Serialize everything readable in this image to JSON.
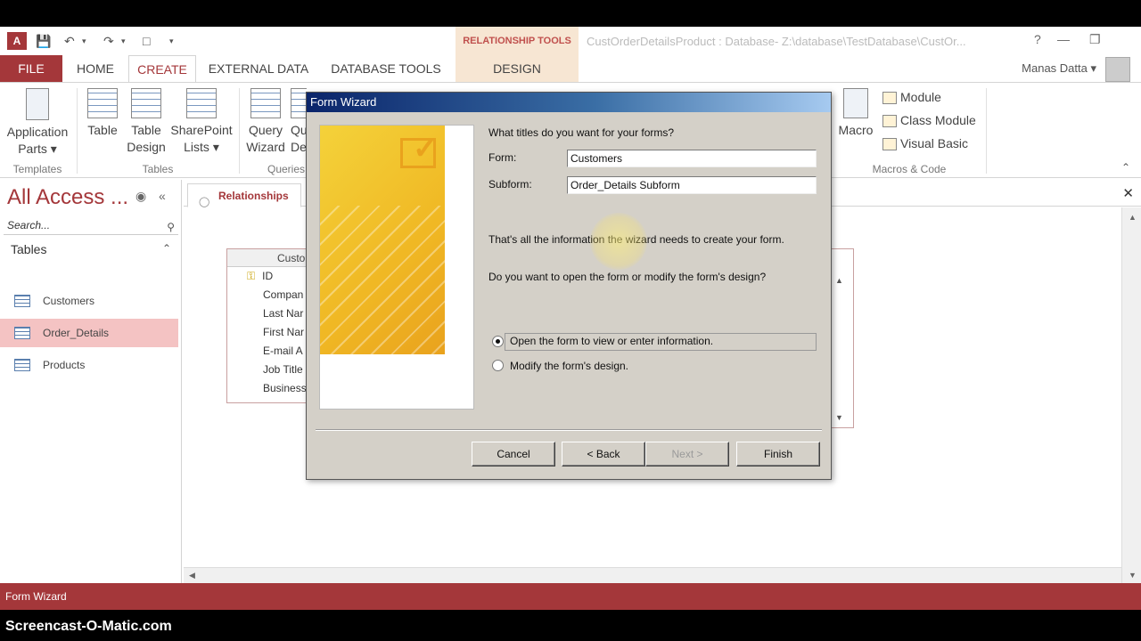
{
  "app": {
    "window_title": "CustOrderDetailsProduct : Database- Z:\\database\\TestDatabase\\CustOr...",
    "user_name": "Manas Datta",
    "contextual_group": "RELATIONSHIP TOOLS"
  },
  "ribbon_tabs": [
    {
      "label": "FILE"
    },
    {
      "label": "HOME"
    },
    {
      "label": "CREATE"
    },
    {
      "label": "EXTERNAL DATA"
    },
    {
      "label": "DATABASE TOOLS"
    },
    {
      "label": "DESIGN"
    }
  ],
  "ribbon": {
    "app_parts": "Application Parts ▾",
    "table": "Table",
    "table_design": "Table Design",
    "sharepoint_lists": "SharePoint Lists ▾",
    "query_wizard": "Query Wizard",
    "query_design": "Qu... De...",
    "macro": "Macro",
    "module": "Module",
    "class_module": "Class Module",
    "visual_basic": "Visual Basic",
    "group_templates": "Templates",
    "group_tables": "Tables",
    "group_queries": "Queries",
    "group_macros": "Macros & Code"
  },
  "nav": {
    "title": "All Access ...",
    "search_placeholder": "Search...",
    "section": "Tables",
    "items": [
      {
        "label": "Customers"
      },
      {
        "label": "Order_Details"
      },
      {
        "label": "Products"
      }
    ]
  },
  "document": {
    "tab_label": "Relationships",
    "table_box": {
      "header": "Custo",
      "fields": [
        "ID",
        "Compan",
        "Last Nar",
        "First Nar",
        "E-mail A",
        "Job Title",
        "Business"
      ]
    }
  },
  "dialog": {
    "title": "Form Wizard",
    "question": "What titles do you want for your forms?",
    "form_label": "Form:",
    "form_value": "Customers",
    "subform_label": "Subform:",
    "subform_value": "Order_Details Subform",
    "info": "That's all the information the wizard needs to create your form.",
    "open_question": "Do you want to open the form or modify the form's design?",
    "option_open": "Open the form to view or enter information.",
    "option_modify": "Modify the form's design.",
    "buttons": {
      "cancel": "Cancel",
      "back": "< Back",
      "next": "Next >",
      "finish": "Finish"
    }
  },
  "status": {
    "text": "Form Wizard"
  },
  "watermark": "Screencast-O-Matic.com",
  "colors": {
    "accent": "#a4373a",
    "dialog_bg": "#d4d0c8",
    "title_gradient_start": "#0a246a"
  }
}
